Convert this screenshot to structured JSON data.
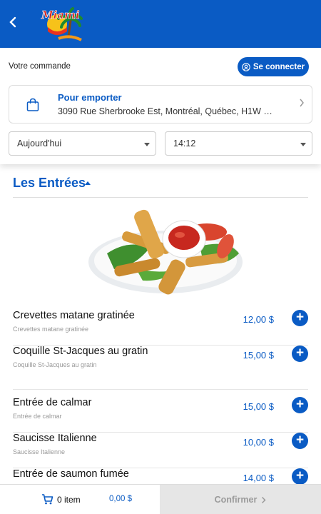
{
  "header": {
    "back_icon": "chevron-left-icon",
    "logo_text": "Miami"
  },
  "order": {
    "label": "Votre commande",
    "connect_label": "Se connecter",
    "pickup_title": "Pour emporter",
    "pickup_address": "3090 Rue Sherbrooke Est, Montréal, Québec, H1W …",
    "day_value": "Aujourd'hui",
    "time_value": "14:12"
  },
  "section": {
    "title": "Les Entrées"
  },
  "items": [
    {
      "name": "Crevettes matane gratinée",
      "desc": "Crevettes matane gratinée",
      "price": "12,00 $"
    },
    {
      "name": "Coquille St-Jacques au gratin",
      "desc": "Coquille St-Jacques au gratin",
      "price": "15,00 $"
    },
    {
      "name": "Entrée de calmar",
      "desc": "Entrée de calmar",
      "price": "15,00 $"
    },
    {
      "name": "Saucisse Italienne",
      "desc": "Saucisse Italienne",
      "price": "10,00 $"
    },
    {
      "name": "Entrée de saumon fumée",
      "desc": "",
      "price": "14,00 $"
    }
  ],
  "footer": {
    "item_count": "0 item",
    "total": "0,00 $",
    "confirm_label": "Confirmer"
  },
  "colors": {
    "primary": "#0a5bc4",
    "disabled_bg": "#e6e6e6"
  }
}
